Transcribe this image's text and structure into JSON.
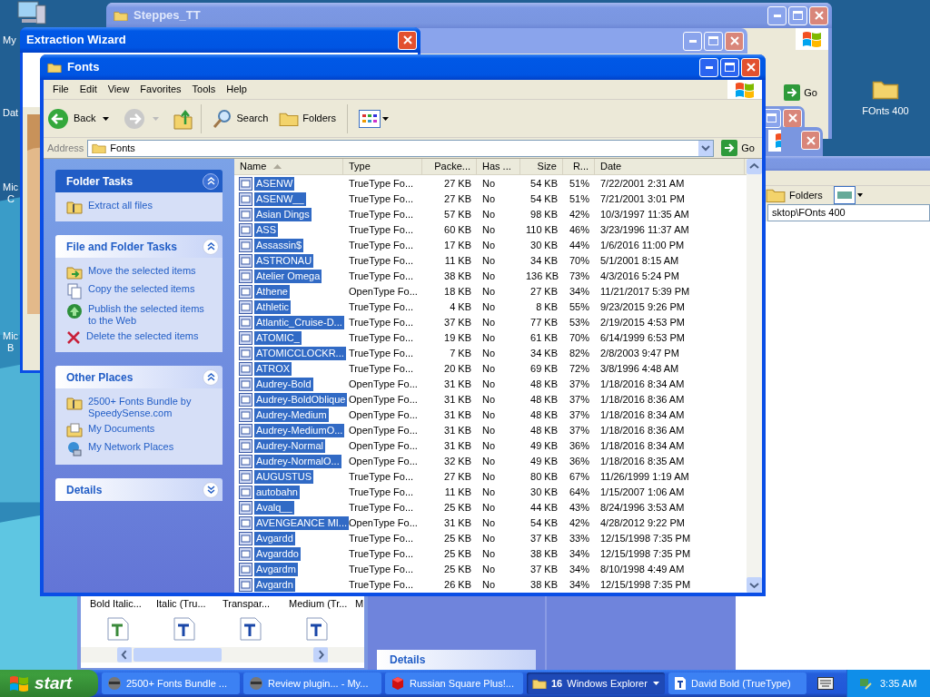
{
  "desktop": {
    "left_icons": [
      {
        "label": "My",
        "kind": "computer"
      },
      {
        "label": "Dat",
        "kind": "label_only"
      },
      {
        "label": "Mic",
        "second_line": "C",
        "kind": "label_only"
      },
      {
        "label": "Mic",
        "second_line": "B",
        "kind": "label_only"
      }
    ],
    "right_icon": {
      "label": "FOnts 400"
    }
  },
  "steppes_window": {
    "title": "Steppes_TT",
    "active": false,
    "go": "Go"
  },
  "wizard_window": {
    "title": "Extraction Wizard",
    "active": true
  },
  "explorer_behind": {
    "active": false,
    "folders": "Folders",
    "address": "sktop\\FOnts 400",
    "details": "Details"
  },
  "font_viewer": {
    "items": [
      "Bold Italic...",
      "Italic (Tru...",
      "Transpar...",
      "Medium (Tr...",
      "M"
    ]
  },
  "fonts_window": {
    "title": "Fonts",
    "active": true,
    "menu": [
      "File",
      "Edit",
      "View",
      "Favorites",
      "Tools",
      "Help"
    ],
    "toolbar": {
      "back": "Back",
      "search": "Search",
      "folders": "Folders"
    },
    "address": {
      "label": "Address",
      "value": "Fonts",
      "go": "Go"
    },
    "task_panes": [
      {
        "title": "Folder Tasks",
        "kind": "special",
        "expanded": true,
        "items": [
          {
            "label": "Extract all files",
            "kind": "zip"
          }
        ]
      },
      {
        "title": "File and Folder Tasks",
        "kind": "normal",
        "expanded": true,
        "items": [
          {
            "label": "Move the selected items",
            "kind": "move"
          },
          {
            "label": "Copy the selected items",
            "kind": "copy"
          },
          {
            "label": "Publish the selected items to the Web",
            "kind": "globe"
          },
          {
            "label": "Delete the selected items",
            "kind": "delete"
          }
        ]
      },
      {
        "title": "Other Places",
        "kind": "normal",
        "expanded": true,
        "items": [
          {
            "label": "2500+ Fonts Bundle by SpeedySense.com",
            "kind": "zip"
          },
          {
            "label": "My Documents",
            "kind": "documents"
          },
          {
            "label": "My Network Places",
            "kind": "network"
          }
        ]
      },
      {
        "title": "Details",
        "kind": "normal",
        "expanded": false
      }
    ],
    "columns": [
      {
        "label": "Name",
        "sorted": true
      },
      {
        "label": "Type",
        "sorted": false
      },
      {
        "label": "Packe...",
        "sorted": false
      },
      {
        "label": "Has ...",
        "sorted": false
      },
      {
        "label": "Size",
        "sorted": false
      },
      {
        "label": "R...",
        "sorted": false
      },
      {
        "label": "Date",
        "sorted": false
      }
    ],
    "rows": [
      {
        "name": "ASENW",
        "type": "TrueType Fo...",
        "packed": "27 KB",
        "has": "No",
        "size": "54 KB",
        "ratio": "51%",
        "date": "7/22/2001 2:31 AM",
        "selected": true
      },
      {
        "name": "ASENW__",
        "type": "TrueType Fo...",
        "packed": "27 KB",
        "has": "No",
        "size": "54 KB",
        "ratio": "51%",
        "date": "7/21/2001 3:01 PM",
        "selected": true
      },
      {
        "name": "Asian Dings",
        "type": "TrueType Fo...",
        "packed": "57 KB",
        "has": "No",
        "size": "98 KB",
        "ratio": "42%",
        "date": "10/3/1997 11:35 AM",
        "selected": true
      },
      {
        "name": "ASS",
        "type": "TrueType Fo...",
        "packed": "60 KB",
        "has": "No",
        "size": "110 KB",
        "ratio": "46%",
        "date": "3/23/1996 11:37 AM",
        "selected": true
      },
      {
        "name": "Assassin$",
        "type": "TrueType Fo...",
        "packed": "17 KB",
        "has": "No",
        "size": "30 KB",
        "ratio": "44%",
        "date": "1/6/2016 11:00 PM",
        "selected": true
      },
      {
        "name": "ASTRONAU",
        "type": "TrueType Fo...",
        "packed": "11 KB",
        "has": "No",
        "size": "34 KB",
        "ratio": "70%",
        "date": "5/1/2001 8:15 AM",
        "selected": true
      },
      {
        "name": "Atelier Omega",
        "type": "TrueType Fo...",
        "packed": "38 KB",
        "has": "No",
        "size": "136 KB",
        "ratio": "73%",
        "date": "4/3/2016 5:24 PM",
        "selected": true
      },
      {
        "name": "Athene",
        "type": "OpenType Fo...",
        "packed": "18 KB",
        "has": "No",
        "size": "27 KB",
        "ratio": "34%",
        "date": "11/21/2017 5:39 PM",
        "selected": true
      },
      {
        "name": "Athletic",
        "type": "TrueType Fo...",
        "packed": "4 KB",
        "has": "No",
        "size": "8 KB",
        "ratio": "55%",
        "date": "9/23/2015 9:26 PM",
        "selected": true
      },
      {
        "name": "Atlantic_Cruise-D...",
        "type": "TrueType Fo...",
        "packed": "37 KB",
        "has": "No",
        "size": "77 KB",
        "ratio": "53%",
        "date": "2/19/2015 4:53 PM",
        "selected": true
      },
      {
        "name": "ATOMIC_",
        "type": "TrueType Fo...",
        "packed": "19 KB",
        "has": "No",
        "size": "61 KB",
        "ratio": "70%",
        "date": "6/14/1999 6:53 PM",
        "selected": true
      },
      {
        "name": "ATOMICCLOCKR...",
        "type": "TrueType Fo...",
        "packed": "7 KB",
        "has": "No",
        "size": "34 KB",
        "ratio": "82%",
        "date": "2/8/2003 9:47 PM",
        "selected": true
      },
      {
        "name": "ATROX",
        "type": "TrueType Fo...",
        "packed": "20 KB",
        "has": "No",
        "size": "69 KB",
        "ratio": "72%",
        "date": "3/8/1996 4:48 AM",
        "selected": true
      },
      {
        "name": "Audrey-Bold",
        "type": "OpenType Fo...",
        "packed": "31 KB",
        "has": "No",
        "size": "48 KB",
        "ratio": "37%",
        "date": "1/18/2016 8:34 AM",
        "selected": true
      },
      {
        "name": "Audrey-BoldOblique",
        "type": "OpenType Fo...",
        "packed": "31 KB",
        "has": "No",
        "size": "48 KB",
        "ratio": "37%",
        "date": "1/18/2016 8:36 AM",
        "selected": true
      },
      {
        "name": "Audrey-Medium",
        "type": "OpenType Fo...",
        "packed": "31 KB",
        "has": "No",
        "size": "48 KB",
        "ratio": "37%",
        "date": "1/18/2016 8:34 AM",
        "selected": true
      },
      {
        "name": "Audrey-MediumO...",
        "type": "OpenType Fo...",
        "packed": "31 KB",
        "has": "No",
        "size": "48 KB",
        "ratio": "37%",
        "date": "1/18/2016 8:36 AM",
        "selected": true
      },
      {
        "name": "Audrey-Normal",
        "type": "OpenType Fo...",
        "packed": "31 KB",
        "has": "No",
        "size": "49 KB",
        "ratio": "36%",
        "date": "1/18/2016 8:34 AM",
        "selected": true
      },
      {
        "name": "Audrey-NormalO...",
        "type": "OpenType Fo...",
        "packed": "32 KB",
        "has": "No",
        "size": "49 KB",
        "ratio": "36%",
        "date": "1/18/2016 8:35 AM",
        "selected": true
      },
      {
        "name": "AUGUSTUS",
        "type": "TrueType Fo...",
        "packed": "27 KB",
        "has": "No",
        "size": "80 KB",
        "ratio": "67%",
        "date": "11/26/1999 1:19 AM",
        "selected": true
      },
      {
        "name": "autobahn",
        "type": "TrueType Fo...",
        "packed": "11 KB",
        "has": "No",
        "size": "30 KB",
        "ratio": "64%",
        "date": "1/15/2007 1:06 AM",
        "selected": true
      },
      {
        "name": "Avalq__",
        "type": "TrueType Fo...",
        "packed": "25 KB",
        "has": "No",
        "size": "44 KB",
        "ratio": "43%",
        "date": "8/24/1996 3:53 AM",
        "selected": true
      },
      {
        "name": "AVENGEANCE MI...",
        "type": "OpenType Fo...",
        "packed": "31 KB",
        "has": "No",
        "size": "54 KB",
        "ratio": "42%",
        "date": "4/28/2012 9:22 PM",
        "selected": true
      },
      {
        "name": "Avgardd",
        "type": "TrueType Fo...",
        "packed": "25 KB",
        "has": "No",
        "size": "37 KB",
        "ratio": "33%",
        "date": "12/15/1998 7:35 PM",
        "selected": true
      },
      {
        "name": "Avgarddo",
        "type": "TrueType Fo...",
        "packed": "25 KB",
        "has": "No",
        "size": "38 KB",
        "ratio": "34%",
        "date": "12/15/1998 7:35 PM",
        "selected": true
      },
      {
        "name": "Avgardm",
        "type": "TrueType Fo...",
        "packed": "25 KB",
        "has": "No",
        "size": "37 KB",
        "ratio": "34%",
        "date": "8/10/1998 4:49 AM",
        "selected": true
      },
      {
        "name": "Avgardn",
        "type": "TrueType Fo...",
        "packed": "26 KB",
        "has": "No",
        "size": "38 KB",
        "ratio": "34%",
        "date": "12/15/1998 7:35 PM",
        "selected": true
      }
    ]
  },
  "taskbar": {
    "start": "start",
    "tasks": [
      {
        "label": "2500+ Fonts Bundle ...",
        "kind": "app",
        "selected": false
      },
      {
        "label": "Review plugin... - My...",
        "kind": "app",
        "selected": false
      },
      {
        "label": "Russian Square Plus!...",
        "kind": "cube",
        "selected": false
      },
      {
        "count": "16",
        "label": "Windows Explorer",
        "kind": "group",
        "selected": true
      },
      {
        "label": "David Bold (TrueType)",
        "kind": "font",
        "selected": false
      }
    ],
    "clock": "3:35 AM"
  }
}
